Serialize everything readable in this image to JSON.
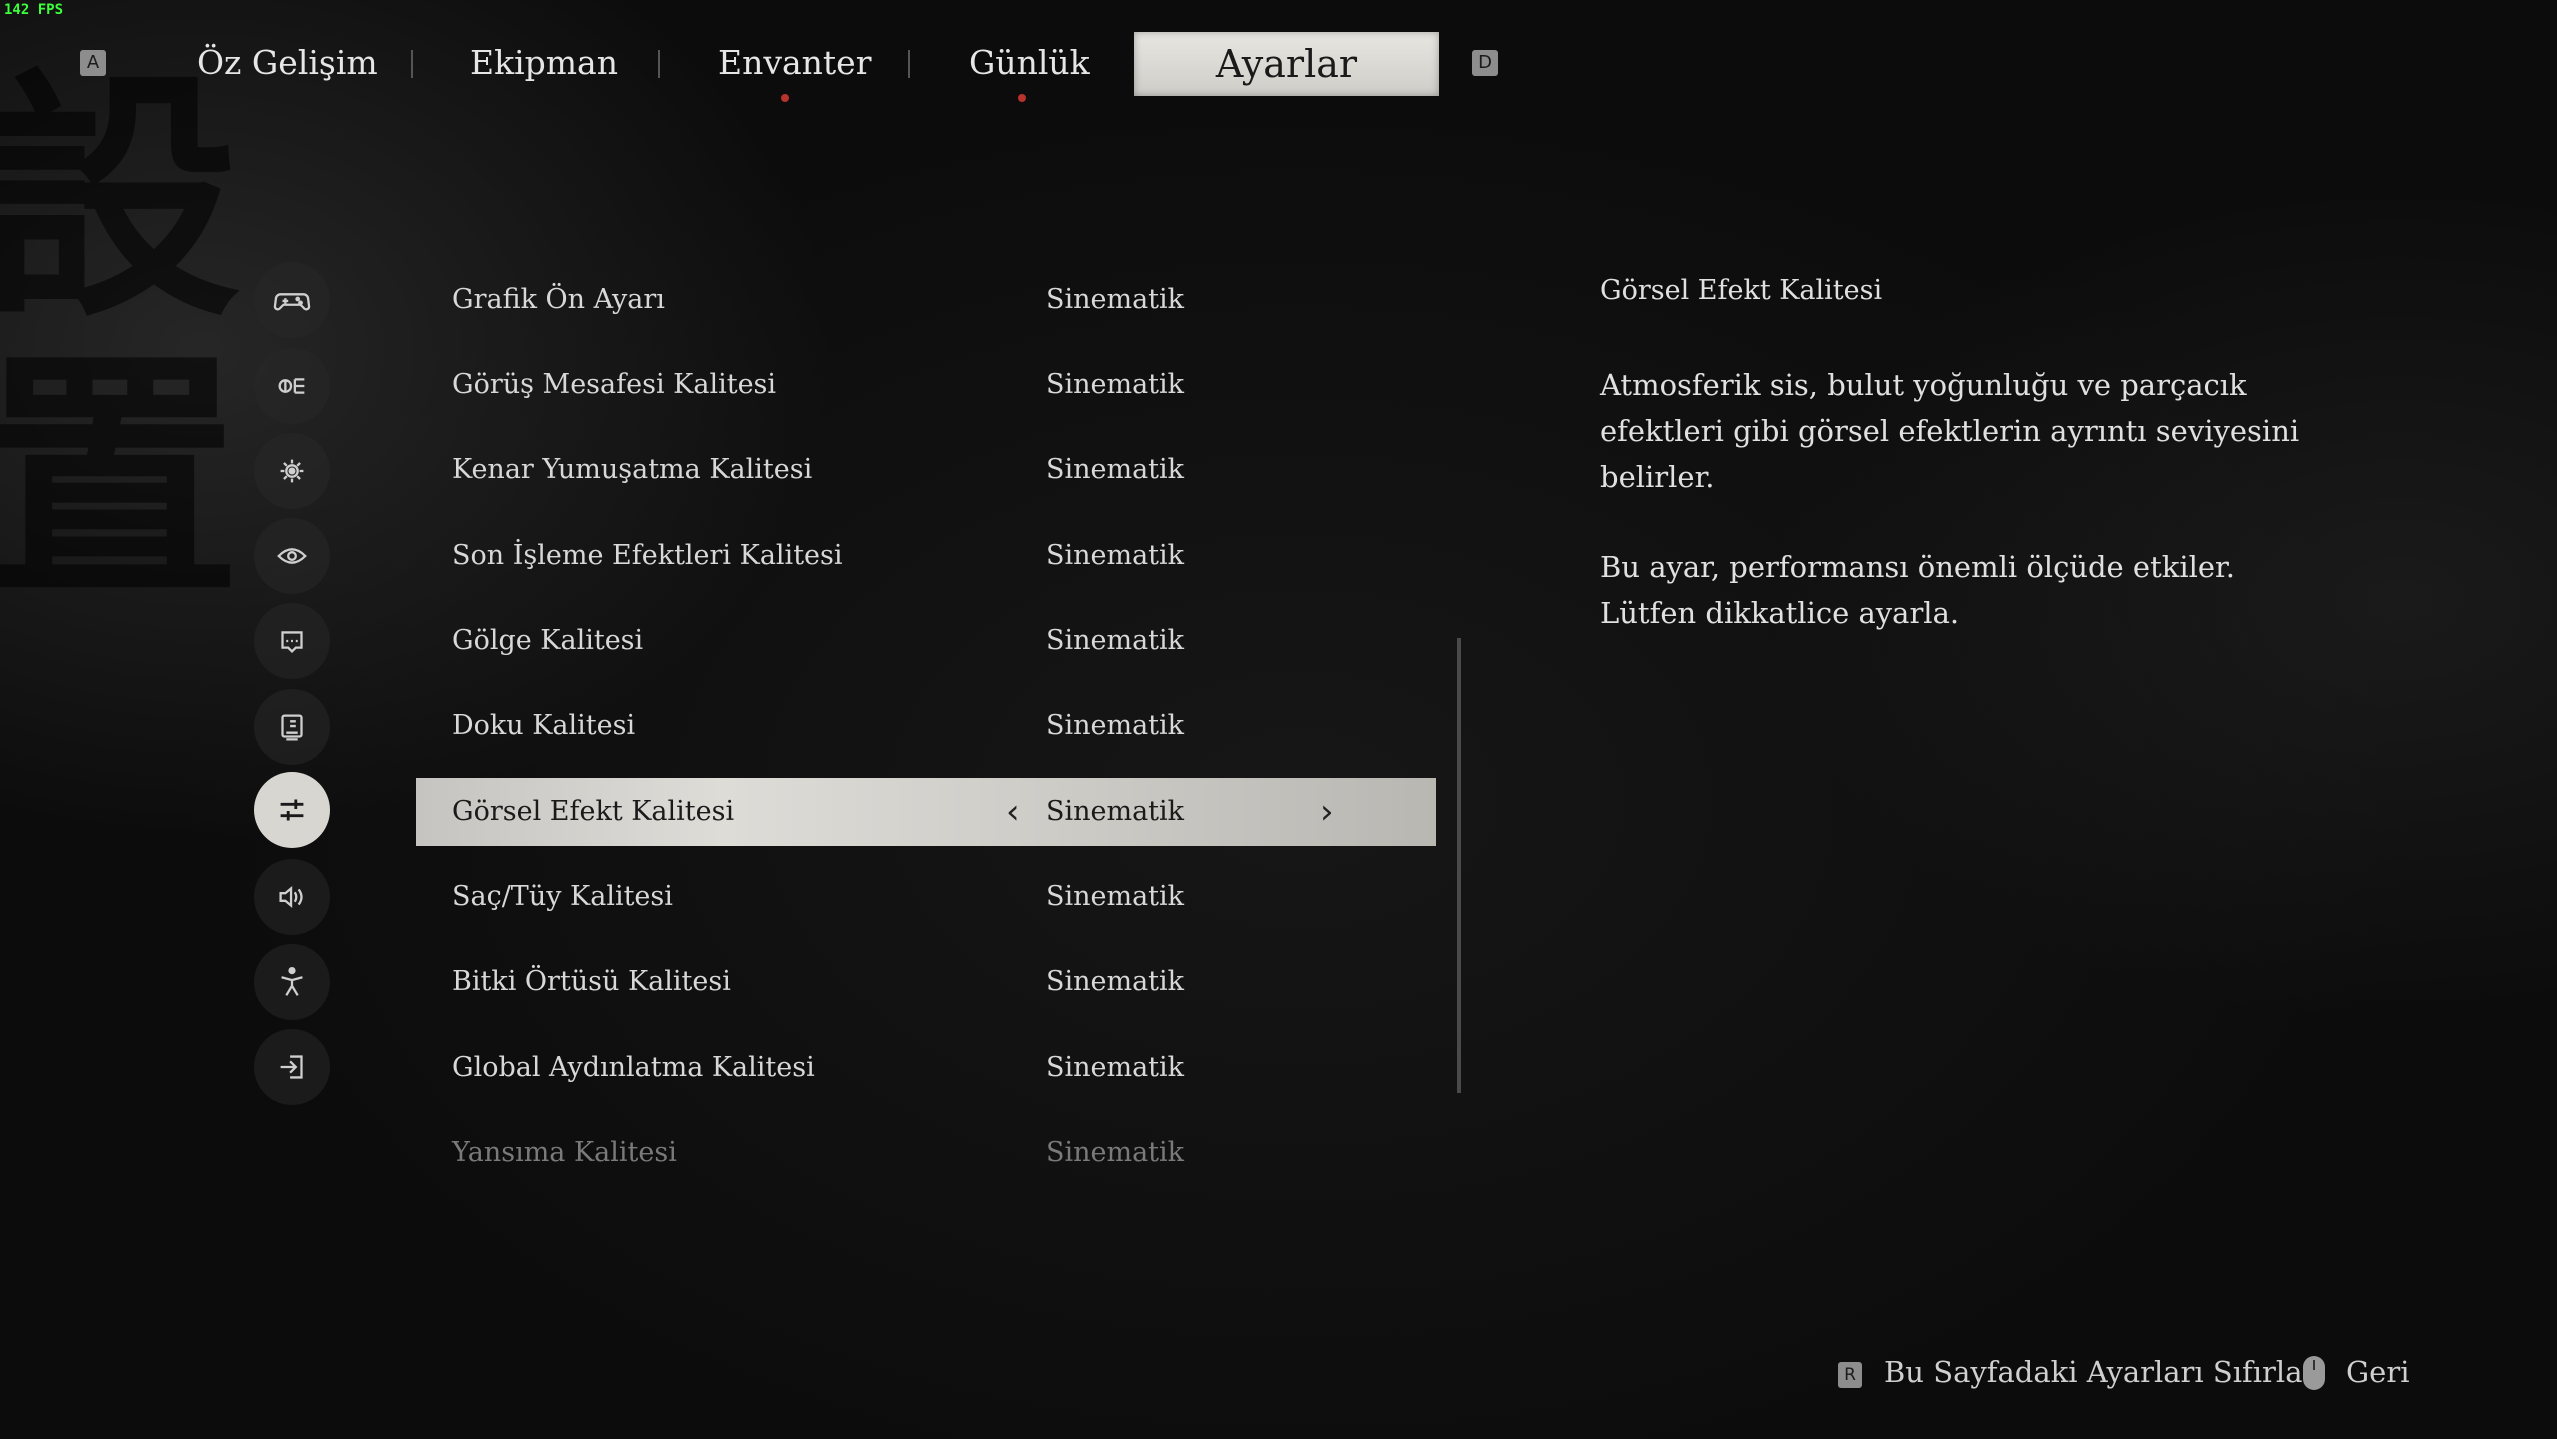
{
  "fps": "142 FPS",
  "calligraphy": "設\n置",
  "nav": {
    "prev_key": "A",
    "next_key": "D",
    "tabs": [
      {
        "label": "Öz Gelişim"
      },
      {
        "label": "Ekipman"
      },
      {
        "label": "Envanter"
      },
      {
        "label": "Günlük"
      },
      {
        "label": "Ayarlar"
      }
    ],
    "active_tab": "Ayarlar"
  },
  "side_icons": [
    {
      "name": "gamepad-icon"
    },
    {
      "name": "display-icon"
    },
    {
      "name": "brightness-icon"
    },
    {
      "name": "eye-icon"
    },
    {
      "name": "monitor-text-icon"
    },
    {
      "name": "screen-icon"
    },
    {
      "name": "sliders-icon",
      "active": true
    },
    {
      "name": "audio-icon"
    },
    {
      "name": "accessibility-icon"
    },
    {
      "name": "exit-icon"
    }
  ],
  "settings": [
    {
      "label": "Grafik Ön Ayarı",
      "value": "Sinematik"
    },
    {
      "label": "Görüş Mesafesi Kalitesi",
      "value": "Sinematik"
    },
    {
      "label": "Kenar Yumuşatma Kalitesi",
      "value": "Sinematik"
    },
    {
      "label": "Son İşleme Efektleri Kalitesi",
      "value": "Sinematik"
    },
    {
      "label": "Gölge Kalitesi",
      "value": "Sinematik"
    },
    {
      "label": "Doku Kalitesi",
      "value": "Sinematik"
    },
    {
      "label": "Görsel Efekt Kalitesi",
      "value": "Sinematik",
      "selected": true
    },
    {
      "label": "Saç/Tüy Kalitesi",
      "value": "Sinematik"
    },
    {
      "label": "Bitki Örtüsü Kalitesi",
      "value": "Sinematik"
    },
    {
      "label": "Global Aydınlatma Kalitesi",
      "value": "Sinematik"
    },
    {
      "label": "Yansıma Kalitesi",
      "value": "Sinematik",
      "faded": true
    }
  ],
  "description": {
    "title": "Görsel Efekt Kalitesi",
    "paragraph1": "Atmosferik sis, bulut yoğunluğu ve parçacık efektleri gibi görsel efektlerin ayrıntı seviyesini belirler.",
    "paragraph2": "Bu ayar, performansı önemli ölçüde etkiler. Lütfen dikkatlice ayarla."
  },
  "footer": {
    "reset_key": "R",
    "reset_label": "Bu Sayfadaki Ayarları Sıfırla",
    "back_label": "Geri"
  },
  "colors": {
    "accent_dot": "#b8332c",
    "selected_bg": "#dedcd7"
  }
}
